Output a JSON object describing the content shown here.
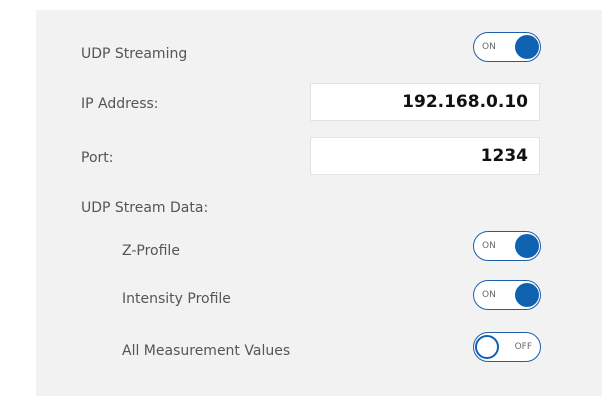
{
  "udp_streaming": {
    "label": "UDP Streaming",
    "toggle_state": "ON"
  },
  "ip_address": {
    "label": "IP Address:",
    "value": "192.168.0.10"
  },
  "port": {
    "label": "Port:",
    "value": "1234"
  },
  "udp_stream_data": {
    "label": "UDP Stream Data:",
    "items": [
      {
        "label": "Z-Profile",
        "toggle_state": "ON"
      },
      {
        "label": "Intensity Profile",
        "toggle_state": "ON"
      },
      {
        "label": "All Measurement Values",
        "toggle_state": "OFF"
      }
    ]
  },
  "colors": {
    "panel_bg": "#f2f2f2",
    "toggle_accent": "#0f62b0",
    "label_text": "#555555"
  }
}
